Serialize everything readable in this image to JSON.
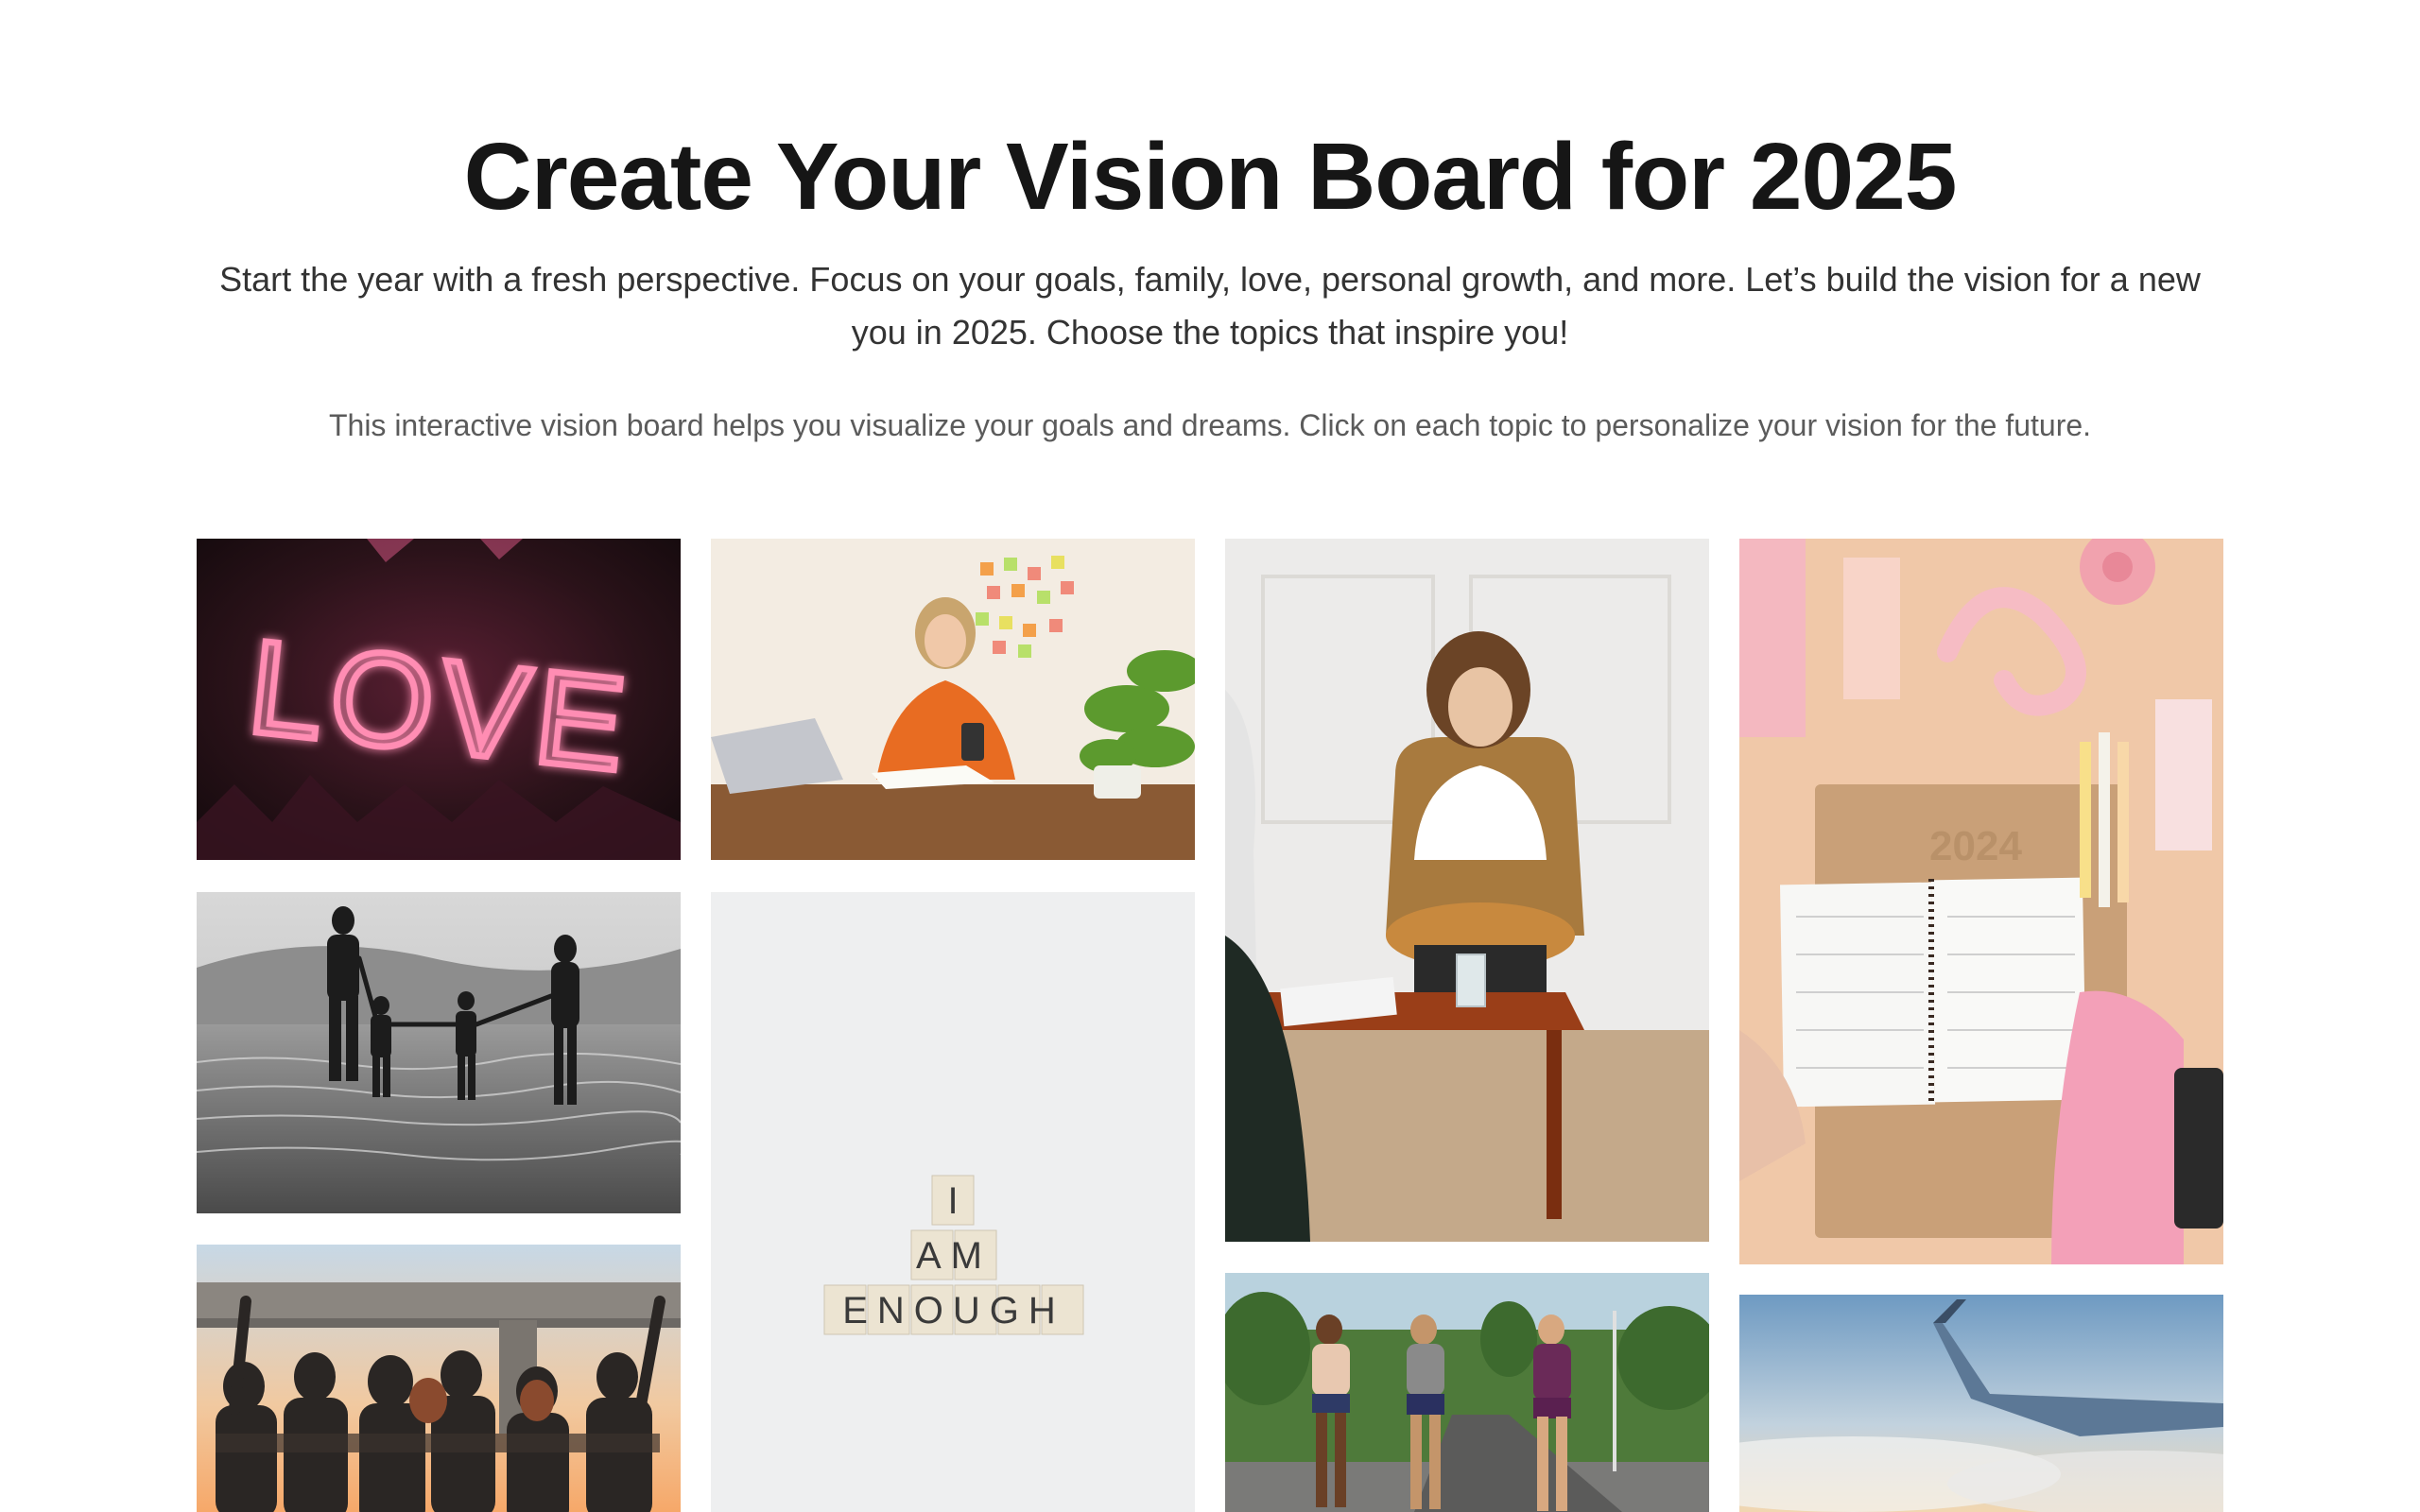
{
  "header": {
    "title": "Create Your Vision Board for 2025",
    "subtitle": "Start the year with a fresh perspective. Focus on your goals, family, love, personal growth, and more. Let’s build the vision for a new you in 2025. Choose the topics that inspire you!",
    "note": "This interactive vision board helps you visualize your goals and dreams. Click on each topic to personalize your vision for the future."
  },
  "tiles": {
    "love": {
      "sign_text": "LOVE"
    },
    "enough": {
      "line1": "I",
      "line2": "AM",
      "line3": "ENOUGH"
    },
    "planner": {
      "year_text": "2024"
    }
  },
  "colors": {
    "love_bg": "#1e1416",
    "love_neon": "#ff7aa8",
    "planner_bg": "#f0c8a8",
    "career_wall": "#f3ece2"
  }
}
